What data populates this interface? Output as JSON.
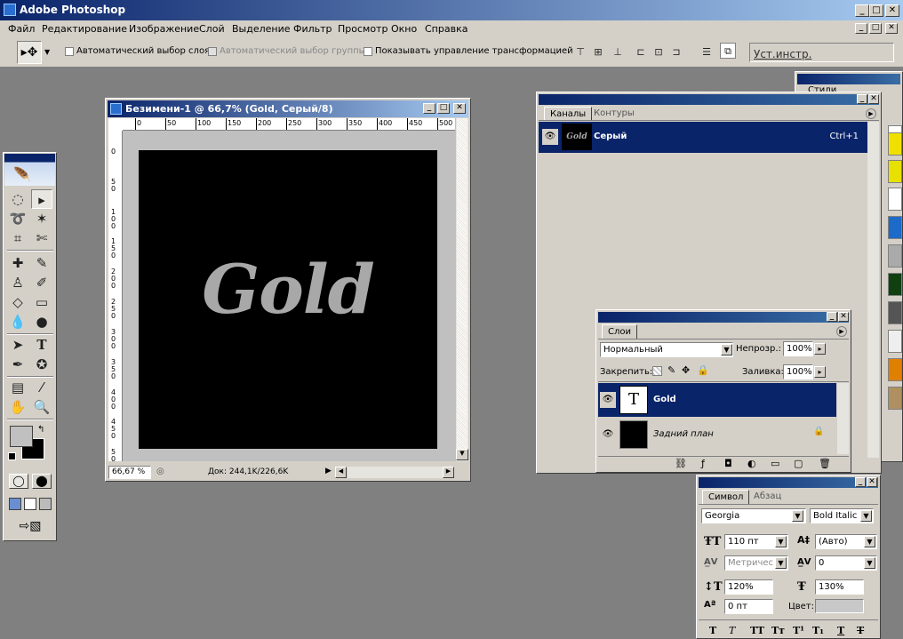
{
  "app": {
    "title": "Adobe Photoshop"
  },
  "window_controls": {
    "minimize": "_",
    "restore": "□",
    "close": "✕"
  },
  "menu": [
    "Файл",
    "Редактирование",
    "Изображение",
    "Слой",
    "Выделение",
    "Фильтр",
    "Просмотр",
    "Окно",
    "Справка"
  ],
  "options": {
    "auto_select_layer": "Автоматический выбор слоя",
    "auto_select_group": "Автоматический выбор группы",
    "show_transform": "Показывать управление трансформацией",
    "presets_label": "Уст.инстр."
  },
  "document": {
    "title": "Безимени-1 @ 66,7% (Gold, Серый/8)",
    "text": "Gold",
    "zoom": "66,67 %",
    "doc_info": "Док: 244,1K/226,6K",
    "ruler_top": [
      "0",
      "50",
      "100",
      "150",
      "200",
      "250",
      "300",
      "350",
      "400",
      "450",
      "500"
    ],
    "ruler_left": [
      "0",
      "5\n0",
      "1\n0\n0",
      "1\n5\n0",
      "2\n0\n0",
      "2\n5\n0",
      "3\n0\n0",
      "3\n5\n0",
      "4\n0\n0",
      "4\n5\n0",
      "5\n0"
    ]
  },
  "channels": {
    "tabs": [
      "Каналы",
      "Контуры"
    ],
    "row": {
      "name": "Серый",
      "shortcut": "Ctrl+1",
      "thumb": "Gold"
    }
  },
  "styles_tab": "Стили",
  "layers": {
    "tab": "Слои",
    "blend_mode": "Нормальный",
    "opacity_label": "Непрозр.:",
    "opacity": "100%",
    "lock_label": "Закрепить:",
    "fill_label": "Заливка:",
    "fill": "100%",
    "items": [
      {
        "name": "Gold",
        "thumb": "T"
      },
      {
        "name": "Задний план",
        "thumb": ""
      }
    ]
  },
  "character": {
    "tabs": [
      "Символ",
      "Абзац"
    ],
    "font_family": "Georgia",
    "font_style": "Bold Italic",
    "size": "110 пт",
    "leading": "(Авто)",
    "kerning": "Метричес",
    "tracking": "0",
    "vscale": "120%",
    "hscale": "130%",
    "baseline": "0 пт",
    "color_label": "Цвет:"
  },
  "colors": {
    "accent": "#0a246a",
    "chrome": "#d4d0c8",
    "workspace": "#808080",
    "gold_text": "#a8a8a8"
  }
}
